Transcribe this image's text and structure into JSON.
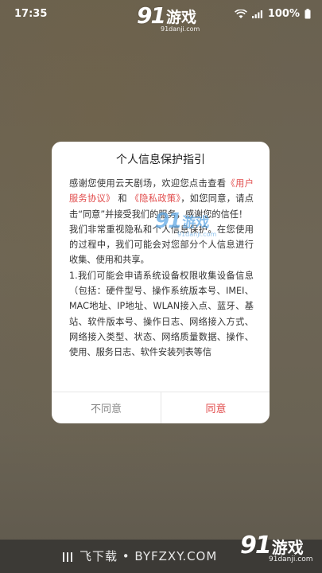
{
  "status_bar": {
    "time": "17:35",
    "battery": "100%"
  },
  "watermark": {
    "logo_number": "91",
    "logo_text": "游戏",
    "url": "91danji.com"
  },
  "dialog": {
    "title": "个人信息保护指引",
    "body": {
      "intro_prefix": "感谢您使用云天剧场，欢迎您点击查看",
      "link_terms": "《用户服务协议》",
      "and": "和",
      "link_privacy": "《隐私政策》",
      "intro_suffix": "，如您同意，请点击“同意”并接受我们的服务，感谢您的信任！",
      "paragraph_2": "我们非常重视隐私和个人信息保护。在您使用的过程中，我们可能会对您部分个人信息进行收集、使用和共享。",
      "paragraph_3": "1.我们可能会申请系统设备权限收集设备信息（包括：硬件型号、操作系统版本号、IMEI、MAC地址、IP地址、WLAN接入点、蓝牙、基站、软件版本号、操作日志、网络接入方式、网络接入类型、状态、网络质量数据、操作、使用、服务日志、软件安装列表等信"
    },
    "disagree_label": "不同意",
    "agree_label": "同意"
  },
  "bottom_bar": {
    "text": "飞下载 • BYFZXY.COM"
  },
  "colors": {
    "accent": "#e14b4b",
    "background": "#6b6356",
    "dialog": "#ffffff"
  }
}
